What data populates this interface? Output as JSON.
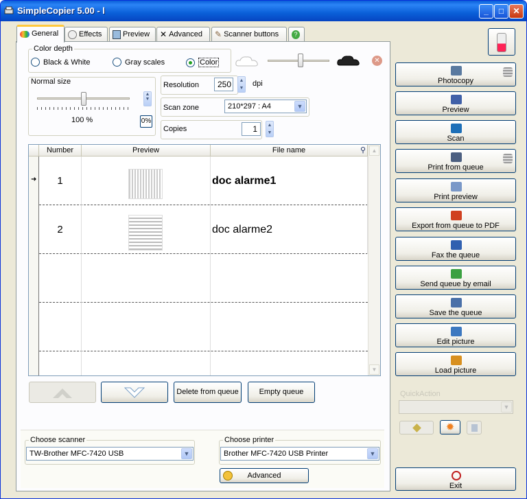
{
  "window": {
    "title": "SimpleCopier 5.00 - l"
  },
  "tabs": [
    {
      "label": "General",
      "icon": "palette-icon"
    },
    {
      "label": "Effects",
      "icon": "effects-icon"
    },
    {
      "label": "Preview",
      "icon": "preview-icon"
    },
    {
      "label": "Advanced",
      "icon": "tools-icon"
    },
    {
      "label": "Scanner buttons",
      "icon": "brush-icon"
    },
    {
      "label": "",
      "icon": "help-icon"
    }
  ],
  "color_depth": {
    "label": "Color depth",
    "options": [
      "Black & White",
      "Gray scales",
      "Color"
    ],
    "selected": "Color"
  },
  "normal_size": {
    "label": "Normal size",
    "value": "100 %",
    "percent_button": "0%"
  },
  "resolution": {
    "label": "Resolution",
    "value": "250",
    "unit": "dpi"
  },
  "scan_zone": {
    "label": "Scan zone",
    "value": "210*297  :  A4"
  },
  "copies": {
    "label": "Copies",
    "value": "1"
  },
  "queue": {
    "columns": [
      "Number",
      "Preview",
      "File name"
    ],
    "rows": [
      {
        "number": "1",
        "file": "doc alarme1",
        "current": true
      },
      {
        "number": "2",
        "file": "doc alarme2",
        "current": false
      }
    ]
  },
  "queue_buttons": {
    "delete": "Delete from queue",
    "empty": "Empty queue"
  },
  "scanner": {
    "label": "Choose scanner",
    "value": "TW-Brother MFC-7420 USB"
  },
  "printer": {
    "label": "Choose printer",
    "value": "Brother MFC-7420 USB Printer"
  },
  "advanced_button": "Advanced",
  "actions": [
    {
      "label": "Photocopy",
      "icon": "photocopy-icon"
    },
    {
      "label": "Preview",
      "icon": "eye-icon"
    },
    {
      "label": "Scan",
      "icon": "scan-icon"
    },
    {
      "label": "Print from queue",
      "icon": "print-queue-icon"
    },
    {
      "label": "Print preview",
      "icon": "magnifier-icon"
    },
    {
      "label": "Export from queue to PDF",
      "icon": "pdf-icon"
    },
    {
      "label": "Fax the queue",
      "icon": "fax-icon"
    },
    {
      "label": "Send queue by email",
      "icon": "email-icon"
    },
    {
      "label": "Save the queue",
      "icon": "save-icon"
    },
    {
      "label": "Edit picture",
      "icon": "edit-icon"
    },
    {
      "label": "Load picture",
      "icon": "load-icon"
    }
  ],
  "quick_action": {
    "label": "QuickAction",
    "value": ""
  },
  "exit_button": "Exit",
  "colors": {
    "title_bar": "#0a5fd8",
    "tab_highlight": "#ffc83c",
    "window_bg": "#ece9d8"
  }
}
